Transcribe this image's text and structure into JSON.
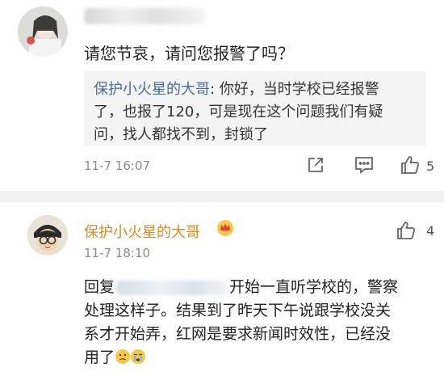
{
  "comment1": {
    "body": "请您节哀，请问您报警了吗？",
    "reply": {
      "author": "保护小火星的大哥",
      "lines": [
        "你好，当时学校已经报警",
        "了，也报了120，可是现在这个问题我们有疑",
        "问，找人都找不到，封锁了"
      ]
    },
    "time": "11-7 16:07",
    "like_count": "5"
  },
  "comment2": {
    "username": "保护小火星的大哥",
    "time": "11-7 18:10",
    "like_count": "4",
    "body": {
      "prefix": "回复",
      "after_mention": "开始一直听学校的，警察",
      "line2": "处理这样子。结果到了昨天下午说跟学校没关",
      "line3": "系才开始弄，红网是要求新闻时效性，已经没",
      "line4": "用了"
    }
  },
  "colors": {
    "link_blue": "#4a6d97",
    "username_orange": "#e08a1e",
    "meta_gray": "#8c8c8c"
  },
  "icons": [
    "share-icon",
    "comment-icon",
    "like-icon",
    "crown-icon",
    "sad-emoji",
    "crying-emoji"
  ]
}
